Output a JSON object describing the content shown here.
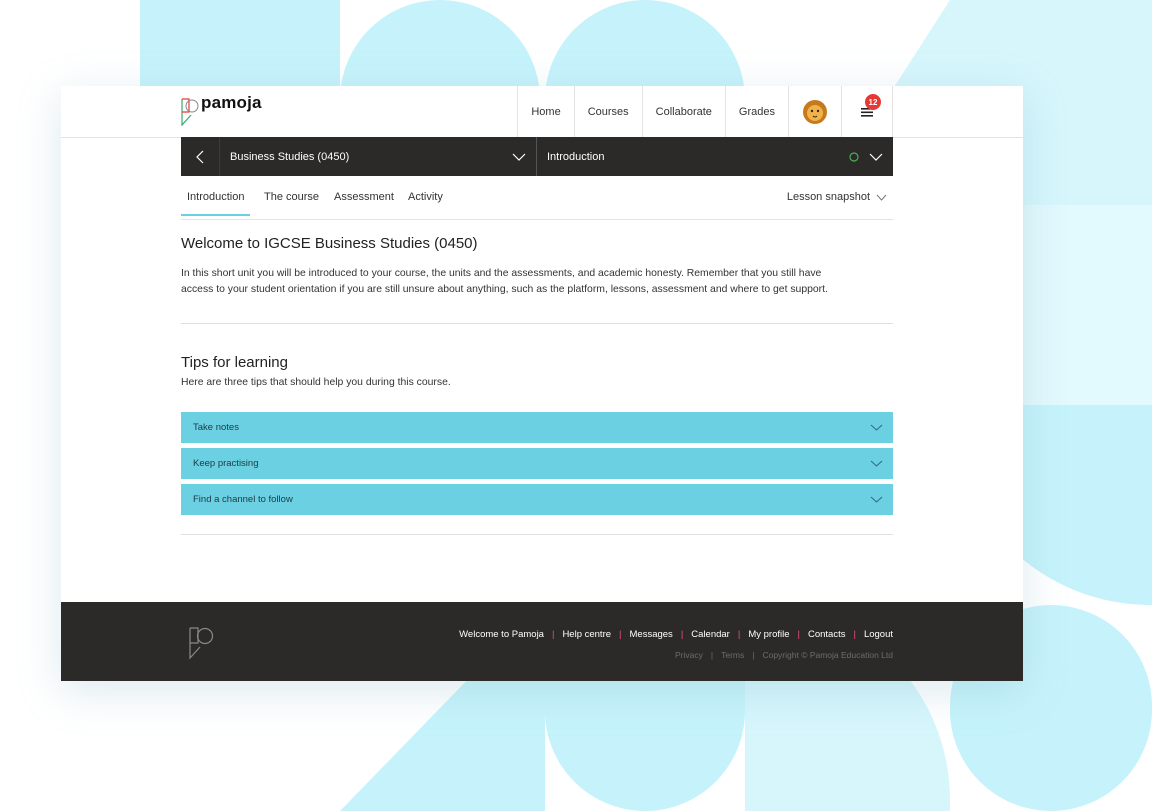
{
  "brand": {
    "name": "pamoja"
  },
  "nav": {
    "items": [
      "Home",
      "Courses",
      "Collaborate",
      "Grades"
    ],
    "notifications_count": "12"
  },
  "coursebar": {
    "course_title": "Business Studies (0450)",
    "lesson_title": "Introduction",
    "status_color": "#4caf50"
  },
  "tabs": {
    "items": [
      "Introduction",
      "The course",
      "Assessment",
      "Activity"
    ],
    "active": "Introduction",
    "snapshot_label": "Lesson snapshot"
  },
  "content": {
    "heading": "Welcome to IGCSE Business Studies (0450)",
    "intro_line1": "In this short unit you will be introduced to your course, the units and the assessments, and academic honesty. Remember that you still have",
    "intro_line2": "access to your student orientation if you are still unsure about anything, such as the platform, lessons, assessment and where to get support.",
    "tips_heading": "Tips for learning",
    "tips_intro": "Here are three tips that should help you during this course.",
    "accordion": [
      "Take notes",
      "Keep practising",
      "Find a channel to follow"
    ]
  },
  "footer": {
    "links": [
      "Welcome to Pamoja",
      "Help centre",
      "Messages",
      "Calendar",
      "My profile",
      "Contacts",
      "Logout"
    ],
    "legal": [
      "Privacy",
      "Terms",
      "Copyright © Pamoja Education Ltd"
    ]
  },
  "colors": {
    "accent": "#6bd0e2",
    "dark": "#2b2a29",
    "badge": "#e53935",
    "separator": "#e84f8a"
  }
}
